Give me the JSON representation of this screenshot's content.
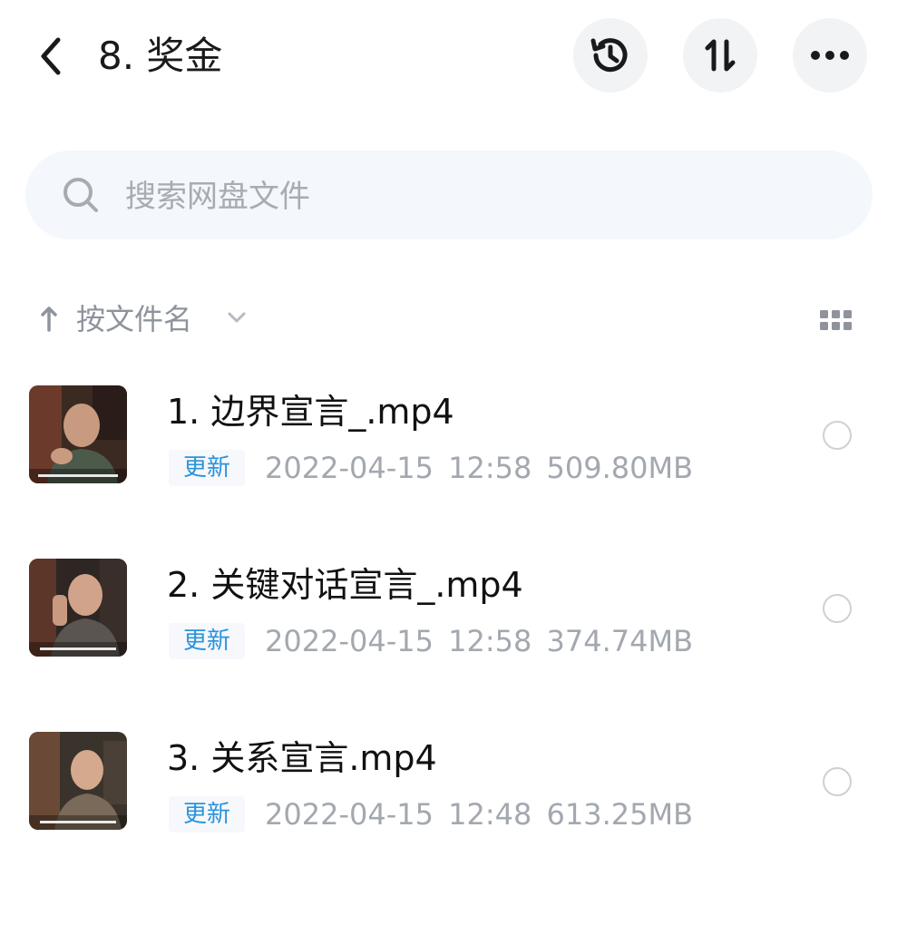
{
  "header": {
    "title": "8. 奖金"
  },
  "search": {
    "placeholder": "搜索网盘文件"
  },
  "sort": {
    "label": "按文件名"
  },
  "files": [
    {
      "name": "1. 边界宣言_.mp4",
      "badge": "更新",
      "meta": "2022-04-15  12:58  509.80MB"
    },
    {
      "name": "2. 关键对话宣言_.mp4",
      "badge": "更新",
      "meta": "2022-04-15  12:58  374.74MB"
    },
    {
      "name": "3. 关系宣言.mp4",
      "badge": "更新",
      "meta": "2022-04-15  12:48  613.25MB"
    }
  ],
  "colors": {
    "accent_badge_text": "#2a93dd",
    "meta_text": "#a3a8b0",
    "search_bg": "#f4f7fb"
  }
}
